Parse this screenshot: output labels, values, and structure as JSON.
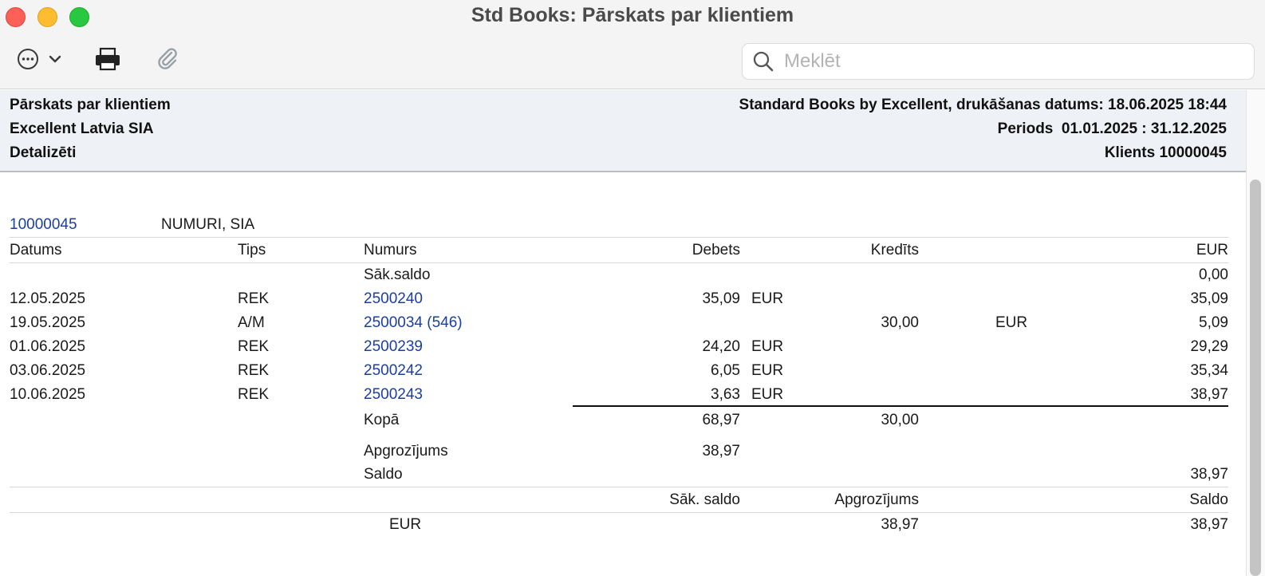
{
  "window": {
    "title": "Std Books: Pārskats par klientiem"
  },
  "toolbar": {
    "search_placeholder": "Meklēt"
  },
  "header": {
    "report_name": "Pārskats par klientiem",
    "company": "Excellent Latvia SIA",
    "mode": "Detalizēti",
    "printed": "Standard Books by Excellent, drukāšanas datums: 18.06.2025 18:44",
    "period": "Periods  01.01.2025 : 31.12.2025",
    "client": "Klients 10000045"
  },
  "customer": {
    "code": "10000045",
    "name": "NUMURI, SIA"
  },
  "columns": {
    "date": "Datums",
    "type": "Tips",
    "number": "Numurs",
    "debit": "Debets",
    "credit": "Kredīts",
    "currency": "EUR"
  },
  "opening": {
    "label": "Sāk.saldo",
    "balance": "0,00"
  },
  "rows": [
    {
      "date": "12.05.2025",
      "type": "REK",
      "number": "2500240",
      "debit": "35,09",
      "debit_cur": "EUR",
      "credit": "",
      "credit_cur": "",
      "balance": "35,09"
    },
    {
      "date": "19.05.2025",
      "type": "A/M",
      "number": "2500034 (546)",
      "debit": "",
      "debit_cur": "",
      "credit": "30,00",
      "credit_cur": "EUR",
      "balance": "5,09"
    },
    {
      "date": "01.06.2025",
      "type": "REK",
      "number": "2500239",
      "debit": "24,20",
      "debit_cur": "EUR",
      "credit": "",
      "credit_cur": "",
      "balance": "29,29"
    },
    {
      "date": "03.06.2025",
      "type": "REK",
      "number": "2500242",
      "debit": "6,05",
      "debit_cur": "EUR",
      "credit": "",
      "credit_cur": "",
      "balance": "35,34"
    },
    {
      "date": "10.06.2025",
      "type": "REK",
      "number": "2500243",
      "debit": "3,63",
      "debit_cur": "EUR",
      "credit": "",
      "credit_cur": "",
      "balance": "38,97"
    }
  ],
  "totals": {
    "total_label": "Kopā",
    "total_debit": "68,97",
    "total_credit": "30,00",
    "turnover_label": "Apgrozījums",
    "turnover_value": "38,97",
    "saldo_label": "Saldo",
    "saldo_value": "38,97"
  },
  "summary": {
    "header_opening": "Sāk. saldo",
    "header_turnover": "Apgrozījums",
    "header_balance": "Saldo",
    "currency": "EUR",
    "turnover": "38,97",
    "balance": "38,97"
  }
}
